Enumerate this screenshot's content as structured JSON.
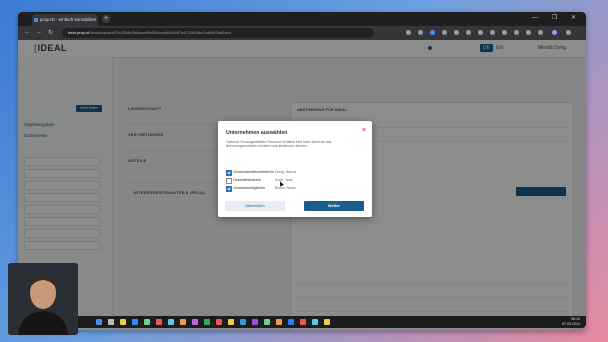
{
  "browser": {
    "tab_title": "prop.ID - einfach immobilien",
    "url_host": "beta.prop.id",
    "url_rest": "/deals/cacaeb27b2254b0b8aaeb8b069cedd6c564f7e6720605bc2ab5f62bb5ce9",
    "win_controls": "— ❐ ✕"
  },
  "app": {
    "logo_text": "IDEAL",
    "lang_de": "DE",
    "lang_en": "EN",
    "user_name": "Mevlüt Dong"
  },
  "sidebar": {
    "items": [
      "Objektangaben",
      "Dokumente"
    ],
    "blurred_button": "Deal Teilen"
  },
  "main": {
    "section1_label": "LIEGENSCHAFT",
    "section2_label": "VERTRETUNGEN",
    "section3_label": "ANTEILE",
    "section4_label": "INTERESSENTENANTEILE (RELA)"
  },
  "right_panel": {
    "header": "ABSTIMMUNG FÜR IDEAL"
  },
  "modal": {
    "title": "Unternehmen auswählen",
    "close_icon": "×",
    "description": "Optional: Es ausgewählten Personen erhalten eine Mail, damit sie das Betreuungsvorhaben erhalten und abstimmen können.",
    "rows": [
      {
        "checked": true,
        "role": "Gemeinschaftsvertreter/in",
        "name": "Dong, Hanna"
      },
      {
        "checked": false,
        "role": "Geschäftsleiter/in",
        "name": "Koch, Julia"
      },
      {
        "checked": true,
        "role": "Vorstandsmitglied/in",
        "name": "Braun, Nisan"
      }
    ],
    "secondary_button": "Abbrechen",
    "primary_button": "Weiter"
  },
  "taskbar": {
    "time": "08:15",
    "date": "07.03.2024"
  }
}
